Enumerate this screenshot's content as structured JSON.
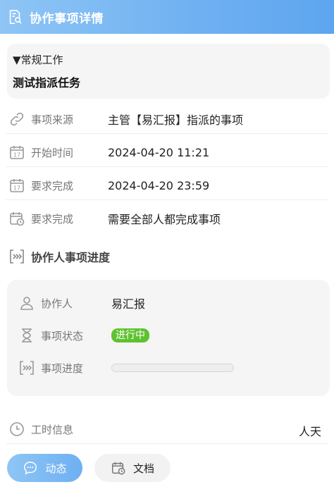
{
  "header": {
    "title": "协作事项详情",
    "icon": "document-search-icon"
  },
  "task": {
    "category": "▼常规工作",
    "title": "测试指派任务"
  },
  "details": [
    {
      "icon": "link-icon",
      "label": "事项来源",
      "value": "主管【易汇报】指派的事项"
    },
    {
      "icon": "calendar-17-icon",
      "label": "开始时间",
      "value": "2024-04-20 11:21"
    },
    {
      "icon": "calendar-17-icon",
      "label": "要求完成",
      "value": "2024-04-20 23:59"
    },
    {
      "icon": "calendar-clock-icon",
      "label": "要求完成",
      "value": "需要全部人都完成事项"
    }
  ],
  "collab_section": {
    "title": "协作人事项进度",
    "icon": "progress-icon"
  },
  "collab": {
    "person_label": "协作人",
    "person": "易汇报",
    "status_label": "事项状态",
    "status": "进行中",
    "progress_label": "事项进度",
    "progress": 0
  },
  "worktime": {
    "label": "工时信息",
    "value": "人天"
  },
  "buttons": {
    "dynamic": "动态",
    "documents": "文档"
  },
  "colors": {
    "accent": "#6fb0f2",
    "status_green": "#5ec230",
    "card_bg": "#f5f5f5"
  }
}
